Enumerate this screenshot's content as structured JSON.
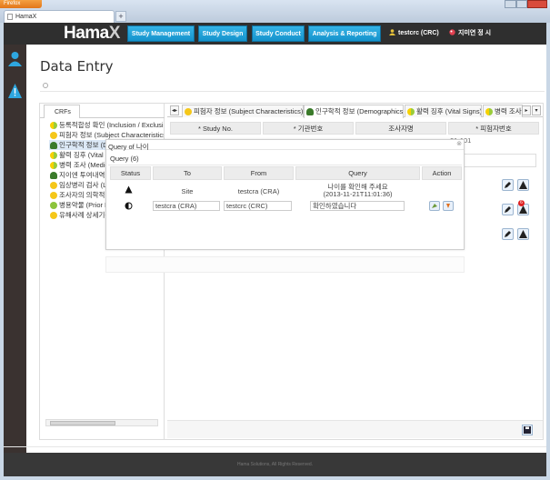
{
  "browser": {
    "app_button": "Firefox",
    "tab_title": "HamaX",
    "new_tab": "+"
  },
  "nav": {
    "logo_text": "Hama",
    "logo_x": "X",
    "buttons": [
      {
        "label": "Study Management"
      },
      {
        "label": "Study Design"
      },
      {
        "label": "Study Conduct"
      },
      {
        "label": "Analysis & Reporting"
      }
    ],
    "user": "testcrc (CRC)",
    "site": "지미연 정 시"
  },
  "page": {
    "title": "Data Entry",
    "footer": "Hama Solutions, All Rights Reserved."
  },
  "crfs": {
    "tab_label": "CRFs",
    "items": [
      {
        "label": "등록적합성 확인 (Inclusion / Exclusion)",
        "status": "half"
      },
      {
        "label": "피험자 정보 (Subject Characteristics)",
        "status": "yellow"
      },
      {
        "label": "인구학적 정보 (Demographics)",
        "status": "person",
        "selected": true
      },
      {
        "label": "활력 징후 (Vital Signs)",
        "status": "half"
      },
      {
        "label": "병력 조사 (Medical History)",
        "status": "half"
      },
      {
        "label": "지이엔 투여내역",
        "status": "person"
      },
      {
        "label": "임상병리 검사 (Laboratory)",
        "status": "yellow"
      },
      {
        "label": "조사자의 의학적 판단",
        "status": "yellow"
      },
      {
        "label": "병용약물 (Prior Medication)",
        "status": "green"
      },
      {
        "label": "유해사례 상세기록",
        "status": "yellow"
      }
    ]
  },
  "form": {
    "tabs": [
      {
        "label": "피험자 정보 (Subject Characteristics)",
        "status": "yellow"
      },
      {
        "label": "인구학적 정보 (Demographics)",
        "status": "person",
        "active": true
      },
      {
        "label": "활력 징후 (Vital Signs)",
        "status": "half"
      },
      {
        "label": "병력 조사",
        "status": "half"
      }
    ],
    "headers": [
      "* Study No.",
      "* 기관번호",
      "조사자명",
      "* 피험자번호"
    ],
    "row_values": [
      "",
      "",
      "",
      "01-101"
    ]
  },
  "dialog": {
    "title": "Query of 나이",
    "subtitle": "Query (6)",
    "headers": [
      "Status",
      "To",
      "From",
      "Query",
      "Action"
    ],
    "rows": [
      {
        "status_icon": "warning-icon",
        "to": "Site",
        "from": "testcra (CRA)",
        "query": "나이를 확인해 주세요",
        "timestamp": "(2013-11-21T11:01:36)"
      },
      {
        "status_icon": "answered-icon",
        "to": "testcra (CRA)",
        "from": "testcrc (CRC)",
        "query": "확인하였습니다"
      }
    ]
  },
  "badges": {
    "query_count": "6"
  }
}
